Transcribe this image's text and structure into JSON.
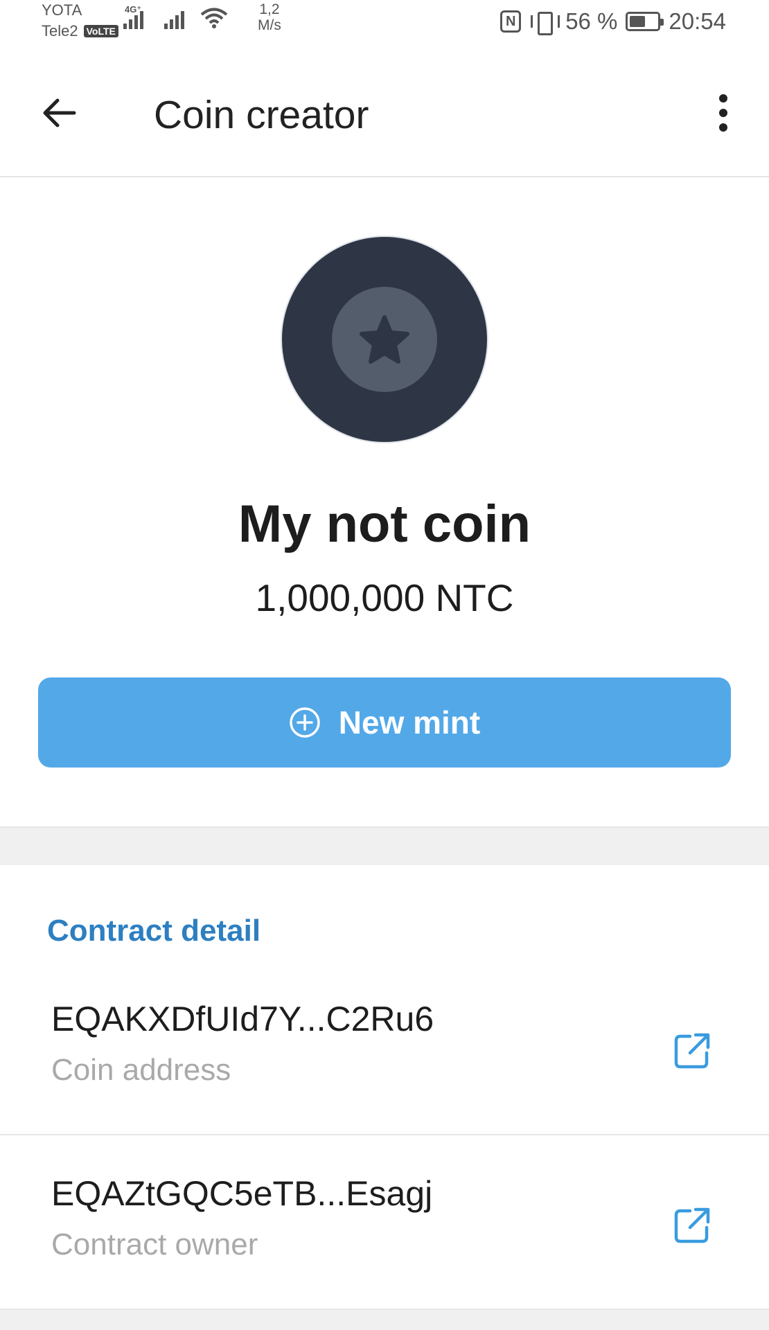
{
  "status_bar": {
    "carrier_1": "YOTA",
    "carrier_2": "Tele2",
    "volte": "VoLTE",
    "network_type": "4G⁺",
    "speed_value": "1,2",
    "speed_unit": "M/s",
    "nfc_label": "N",
    "battery_percent": "56 %",
    "battery_level": 0.56,
    "time": "20:54"
  },
  "app_bar": {
    "title": "Coin creator"
  },
  "coin": {
    "name": "My not coin",
    "supply": "1,000,000 NTC",
    "avatar_colors": {
      "outer": "#2e3646",
      "inner": "#535d6c",
      "star": "#2e3646"
    }
  },
  "mint_button": {
    "label": "New mint",
    "color": "#53a8e8"
  },
  "contract_detail": {
    "title": "Contract detail",
    "title_color": "#2d7fc1",
    "rows": [
      {
        "value": "EQAKXDfUId7Y...C2Ru6",
        "label": "Coin address"
      },
      {
        "value": "EQAZtGQC5eTB...Esagj",
        "label": "Contract owner"
      }
    ]
  }
}
